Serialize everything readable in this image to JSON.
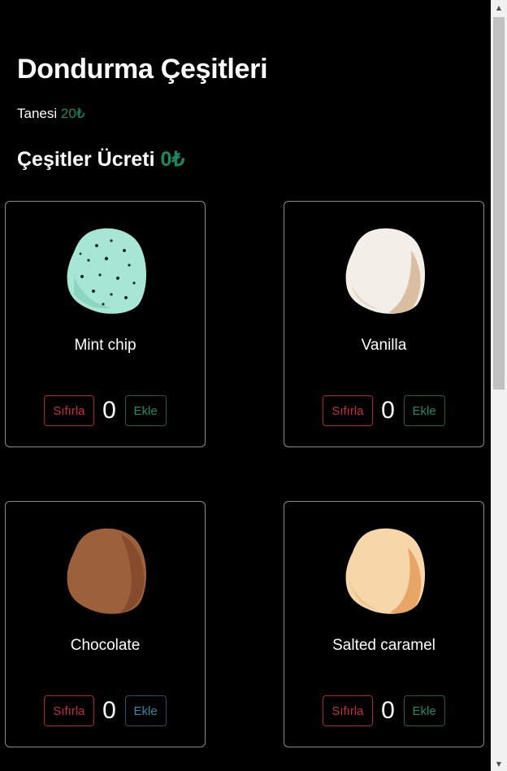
{
  "header": {
    "title": "Dondurma Çeşitleri",
    "unit_label": "Tanesi",
    "unit_price": "20₺",
    "total_label": "Çeşitler Ücreti",
    "total_value": "0₺"
  },
  "reset_label": "Sıfırla",
  "add_label": "Ekle",
  "items": [
    {
      "name": "Mint chip",
      "count": "0",
      "color": "#9fe3cf"
    },
    {
      "name": "Vanilla",
      "count": "0",
      "color": "#f1ece6"
    },
    {
      "name": "Chocolate",
      "count": "0",
      "color": "#9a5d35"
    },
    {
      "name": "Salted caramel",
      "count": "0",
      "color": "#f6d3a4"
    }
  ]
}
